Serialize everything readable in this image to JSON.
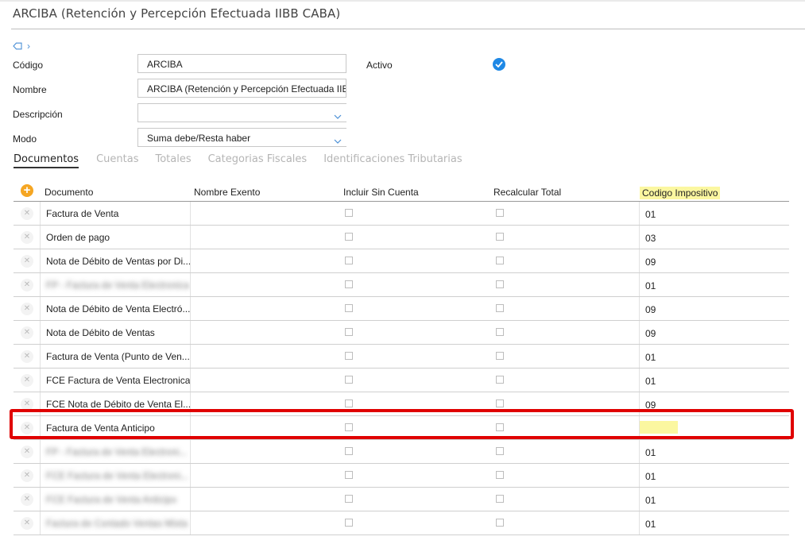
{
  "window": {
    "title": "ARCIBA (Retención y Percepción Efectuada IIBB CABA)",
    "tag_icon": "tag-icon",
    "chevron": "›"
  },
  "form": {
    "codigo": {
      "label": "Código",
      "value": "ARCIBA"
    },
    "nombre": {
      "label": "Nombre",
      "value": "ARCIBA (Retención y Percepción Efectuada IIB"
    },
    "descripcion": {
      "label": "Descripción",
      "value": ""
    },
    "modo": {
      "label": "Modo",
      "value": "Suma debe/Resta haber"
    },
    "activo": {
      "label": "Activo",
      "checked": true
    }
  },
  "tabs": [
    {
      "label": "Documentos",
      "active": true
    },
    {
      "label": "Cuentas",
      "active": false
    },
    {
      "label": "Totales",
      "active": false
    },
    {
      "label": "Categorias Fiscales",
      "active": false
    },
    {
      "label": "Identificaciones Tributarias",
      "active": false
    }
  ],
  "grid": {
    "columns": {
      "documento": "Documento",
      "nombre_exento": "Nombre Exento",
      "incluir_sin_cuenta": "Incluir Sin Cuenta",
      "recalcular_total": "Recalcular Total",
      "codigo_impositivo": "Codigo Impositivo"
    },
    "rows": [
      {
        "documento": "Factura de Venta",
        "blurred": false,
        "codigo": "01"
      },
      {
        "documento": "Orden de pago",
        "blurred": false,
        "codigo": "03"
      },
      {
        "documento": "Nota de Débito de Ventas por Di...",
        "blurred": false,
        "codigo": "09"
      },
      {
        "documento": "FP - Factura de Venta Electronica",
        "blurred": true,
        "codigo": "01"
      },
      {
        "documento": "Nota de Débito de Venta Electró...",
        "blurred": false,
        "codigo": "09"
      },
      {
        "documento": "Nota de Débito de Ventas",
        "blurred": false,
        "codigo": "09"
      },
      {
        "documento": "Factura de Venta (Punto de Ven...",
        "blurred": false,
        "codigo": "01"
      },
      {
        "documento": "FCE Factura de Venta Electronica",
        "blurred": false,
        "codigo": "01"
      },
      {
        "documento": "FCE Nota de Débito de Venta El...",
        "blurred": false,
        "codigo": "09"
      },
      {
        "documento": "Factura de Venta Anticipo",
        "blurred": false,
        "codigo": "",
        "highlighted": true
      },
      {
        "documento": "FP - Factura de Venta Electroni...",
        "blurred": true,
        "codigo": "01"
      },
      {
        "documento": "FCE Factura de Venta Electroni...",
        "blurred": true,
        "codigo": "01"
      },
      {
        "documento": "FCE Factura de Venta Anticipo",
        "blurred": true,
        "codigo": "01"
      },
      {
        "documento": "Factura de Contado Ventas Mixta",
        "blurred": true,
        "codigo": "01"
      }
    ]
  },
  "colors": {
    "accent": "#1e88e5",
    "add_button": "#f5a623",
    "highlight": "#fbf7a0",
    "red_box": "#e00000"
  }
}
